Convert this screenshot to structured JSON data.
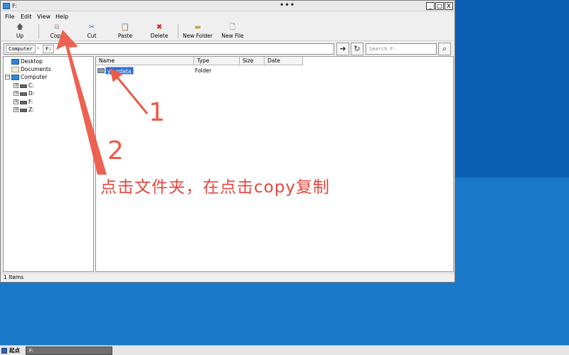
{
  "window": {
    "title": "F:",
    "title_dots": "•••",
    "controls": [
      "_",
      "□",
      "X"
    ]
  },
  "menu": [
    "File",
    "Edit",
    "View",
    "Help"
  ],
  "toolbar": [
    {
      "label": "Up",
      "icon": "up-arrow-icon"
    },
    {
      "label": "Copy",
      "icon": "copy-icon"
    },
    {
      "label": "Cut",
      "icon": "scissors-icon"
    },
    {
      "label": "Paste",
      "icon": "paste-icon"
    },
    {
      "label": "Delete",
      "icon": "delete-x-icon"
    },
    {
      "label": "New Folder",
      "icon": "new-folder-icon"
    },
    {
      "label": "New File",
      "icon": "new-file-icon"
    }
  ],
  "address": {
    "crumbs": [
      "Computer",
      "F:"
    ],
    "search_placeholder": "Search F:"
  },
  "tree": [
    {
      "label": "Desktop",
      "icon": "monitor-icon"
    },
    {
      "label": "Documents",
      "icon": "documents-icon"
    },
    {
      "label": "Computer",
      "icon": "monitor-icon",
      "expander": "−"
    },
    {
      "label": "C:",
      "icon": "drive-icon",
      "expander": "+"
    },
    {
      "label": "D:",
      "icon": "drive-icon",
      "expander": "+"
    },
    {
      "label": "F:",
      "icon": "drive-icon",
      "expander": "+"
    },
    {
      "label": "Z:",
      "icon": "drive-icon",
      "expander": "+"
    }
  ],
  "list": {
    "columns": [
      "Name",
      "Type",
      "Size",
      "Date"
    ],
    "rows": [
      {
        "name": "yourdata",
        "type": "Folder",
        "size": "",
        "date": "",
        "selected": true
      }
    ]
  },
  "status": "1 Items",
  "taskbar": {
    "start_label": "起点",
    "task_label": "F:"
  },
  "annotations": {
    "num1": "1",
    "num2": "2",
    "caption": "点击文件夹，在点击copy复制",
    "color": "#ec5a48"
  }
}
